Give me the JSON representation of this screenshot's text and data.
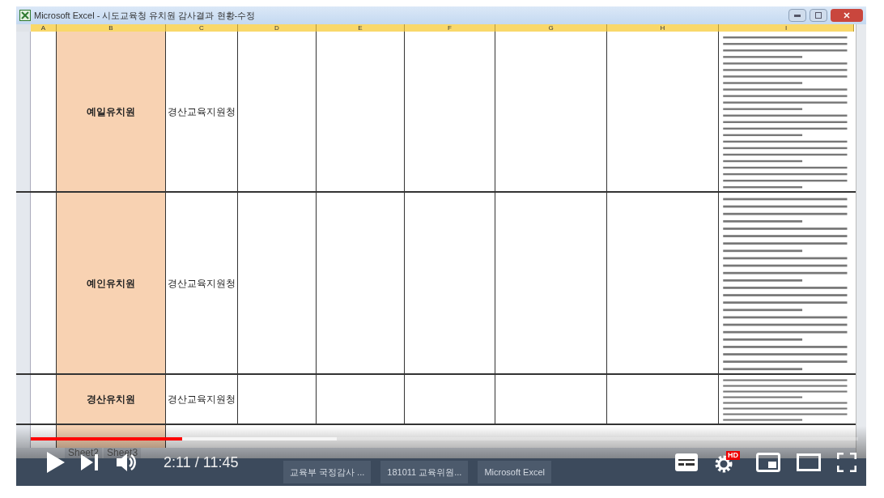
{
  "window": {
    "title": "Microsoft Excel - 시도교육청 유치원 감사결과 현황-수정"
  },
  "columns": [
    "A",
    "B",
    "C",
    "D",
    "E",
    "F",
    "G",
    "H",
    "I"
  ],
  "rows": [
    {
      "name": "예일유치원",
      "office": "경산교육지원청"
    },
    {
      "name": "예인유치원",
      "office": "경산교육지원청"
    },
    {
      "name": "경산유치원",
      "office": "경산교육지원청"
    }
  ],
  "sheet_tabs": [
    {
      "label": "Sheet2",
      "selected": false
    },
    {
      "label": "Sheet3",
      "selected": false
    }
  ],
  "taskbar": {
    "tasks": [
      {
        "label": "교육부 국정감사 ..."
      },
      {
        "label": "181011 교육위원..."
      },
      {
        "label": "Microsoft Excel"
      }
    ]
  },
  "player": {
    "time": "2:11 / 11:45",
    "progress": {
      "level": 0.183
    },
    "buffered": {
      "level": 0.37
    },
    "hd": "HD"
  }
}
